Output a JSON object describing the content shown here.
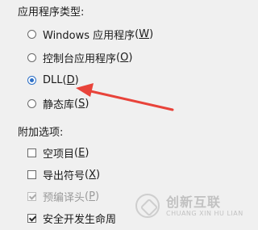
{
  "app_type": {
    "title": "应用程序类型:",
    "options": [
      {
        "label": "Windows 应用程序",
        "mnemonic": "W",
        "selected": false
      },
      {
        "label": "控制台应用程序",
        "mnemonic": "O",
        "selected": false
      },
      {
        "label": "DLL",
        "mnemonic": "D",
        "selected": true
      },
      {
        "label": "静态库",
        "mnemonic": "S",
        "selected": false
      }
    ]
  },
  "additional": {
    "title": "附加选项:",
    "options": [
      {
        "label": "空项目",
        "mnemonic": "E",
        "checked": false,
        "enabled": true
      },
      {
        "label": "导出符号",
        "mnemonic": "X",
        "checked": false,
        "enabled": true
      },
      {
        "label": "预编译头",
        "mnemonic": "P",
        "checked": true,
        "enabled": false
      },
      {
        "label": "安全开发生命周",
        "mnemonic": "",
        "checked": true,
        "enabled": true
      }
    ]
  },
  "watermark": {
    "cn": "创新互联",
    "en": "CHUANG XIN HU LIAN"
  },
  "colors": {
    "annotation_arrow": "#e8433a",
    "radio_selected": "#2c6fc6"
  }
}
